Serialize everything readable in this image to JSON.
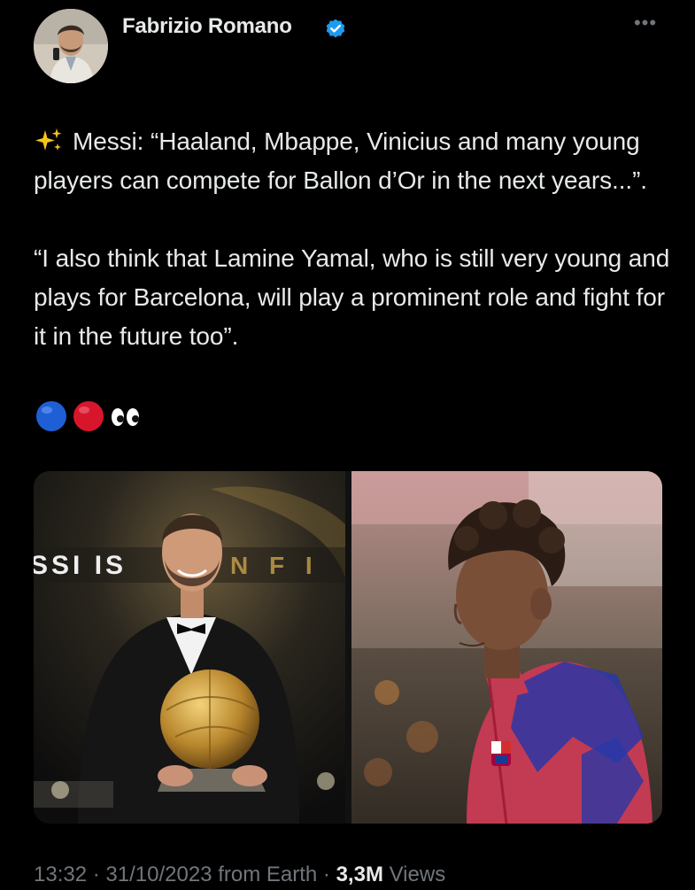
{
  "author": {
    "display_name": "Fabrizio Romano",
    "verified": true,
    "avatar_icon": "profile-photo",
    "verified_color": "#1d9bf0"
  },
  "more_label": "•••",
  "tweet": {
    "paragraph1": "Messi: “Haaland, Mbappe, Vinicius and many young players can compete for Ballon d’Or in the next years...”.",
    "paragraph2": "“I also think that Lamine Yamal, who is still very young and plays for Barcelona, will play a prominent role and fight for it in the future too”.",
    "leading_icon": "sparkles-icon",
    "emoji_icons": [
      "blue-circle-icon",
      "red-circle-icon",
      "eyes-icon"
    ]
  },
  "media": {
    "left_banner_text": "SSI IS",
    "left_banner_text2": "N F I",
    "left_description": "Lionel Messi holding the Ballon d'Or trophy",
    "right_description": "Lamine Yamal in Barcelona kit"
  },
  "meta": {
    "time": "13:32",
    "date": "31/10/2023",
    "source": "from Earth",
    "views_count": "3,3M",
    "views_label": "Views"
  },
  "colors": {
    "background": "#000000",
    "text": "#e7e9ea",
    "muted": "#71767b",
    "accent": "#1d9bf0"
  }
}
